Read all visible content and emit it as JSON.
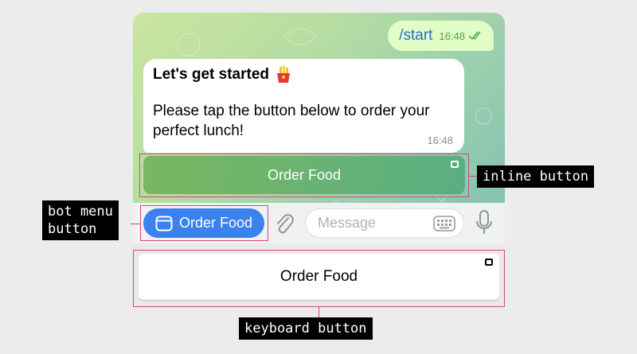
{
  "chat": {
    "outgoing": {
      "text": "/start",
      "time": "16:48"
    },
    "incoming": {
      "title": "Let's get started",
      "emoji": "🍟",
      "body": "Please tap the button below to order your perfect lunch!",
      "time": "16:48"
    },
    "inline_button": {
      "label": "Order Food"
    }
  },
  "input_bar": {
    "menu_button": {
      "label": "Order Food"
    },
    "message_placeholder": "Message"
  },
  "keyboard": {
    "button": {
      "label": "Order Food"
    }
  },
  "annotations": {
    "inline": "inline button",
    "menu_line1": "bot menu",
    "menu_line2": "button",
    "keyboard": "keyboard button"
  },
  "colors": {
    "annotation_frame": "#d2458a",
    "menu_button": "#3b82f0",
    "outgoing_bubble": "#e1fec6"
  },
  "icons": [
    "checkmarks-icon",
    "fries-icon",
    "app-window-icon",
    "paperclip-icon",
    "keyboard-icon",
    "microphone-icon"
  ]
}
